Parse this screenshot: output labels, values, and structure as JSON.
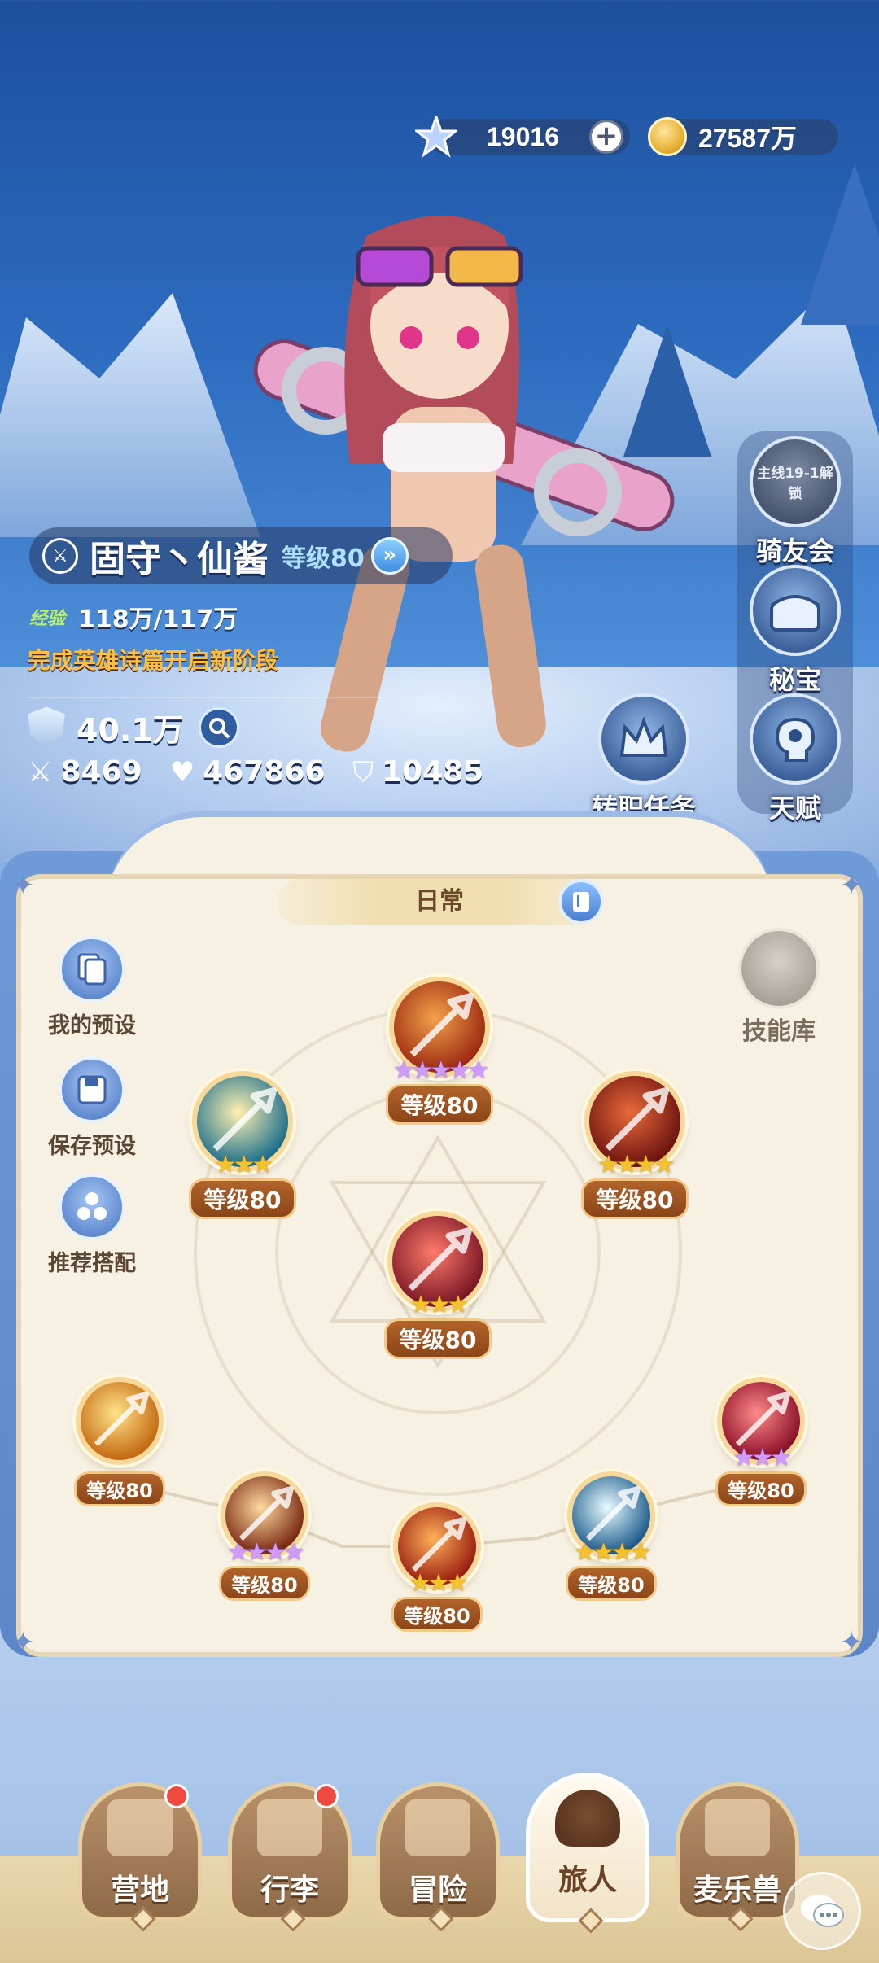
{
  "currency": {
    "star_amount": "19016",
    "gold_amount": "27587万",
    "star_icon": "star-gem-icon",
    "gold_icon": "gold-coin-icon"
  },
  "hero": {
    "name": "固守丶仙酱",
    "level": "等级80",
    "class_icon": "crossed-swords-icon",
    "exp_label": "经验",
    "exp_value": "118万/117万",
    "quest_hint": "完成英雄诗篇开启新阶段",
    "power": "40.1万",
    "attack": "8469",
    "hp": "467866",
    "defense": "10485"
  },
  "side_buttons": {
    "knight_club": {
      "lock_text": "主线19-1解锁",
      "label": "骑友会"
    },
    "treasure": {
      "label": "秘宝"
    },
    "talent": {
      "label": "天赋"
    },
    "job_quest": {
      "label": "转职任务"
    }
  },
  "skill_panel": {
    "tab_label": "日常",
    "my_presets": "我的预设",
    "save_preset": "保存预设",
    "recommended": "推荐搭配",
    "skill_library": "技能库",
    "skills": [
      {
        "level": "等级80",
        "stars": "★★★★★",
        "tier": "purple",
        "colors": [
          "#f1a24a",
          "#9e2a12"
        ]
      },
      {
        "level": "等级80",
        "stars": "★★★",
        "tier": "gold",
        "colors": [
          "#fff2b0",
          "#1d6f8c"
        ]
      },
      {
        "level": "等级80",
        "stars": "★★★★",
        "tier": "gold",
        "colors": [
          "#e96a3a",
          "#6e1410"
        ]
      },
      {
        "level": "等级80",
        "stars": "★★★",
        "tier": "gold",
        "colors": [
          "#ff7a6a",
          "#7a1726"
        ]
      },
      {
        "level": "等级80",
        "stars": "",
        "tier": "gold",
        "colors": [
          "#ffe38a",
          "#c46a12"
        ]
      },
      {
        "level": "等级80",
        "stars": "★★★★",
        "tier": "purple",
        "colors": [
          "#ffd9a0",
          "#7a2a12"
        ]
      },
      {
        "level": "等级80",
        "stars": "★★★",
        "tier": "gold",
        "colors": [
          "#ffb05a",
          "#9a1e10"
        ]
      },
      {
        "level": "等级80",
        "stars": "★★★★",
        "tier": "gold",
        "colors": [
          "#e9fbff",
          "#1d5c8c"
        ]
      },
      {
        "level": "等级80",
        "stars": "★★★",
        "tier": "purple",
        "colors": [
          "#ff8a8a",
          "#8a1028"
        ]
      }
    ]
  },
  "nav": {
    "items": [
      {
        "label": "营地",
        "badge": true
      },
      {
        "label": "行李",
        "badge": true
      },
      {
        "label": "冒险",
        "badge": false
      },
      {
        "label": "旅人",
        "badge": false,
        "active": true
      },
      {
        "label": "麦乐兽",
        "badge": false
      }
    ]
  }
}
